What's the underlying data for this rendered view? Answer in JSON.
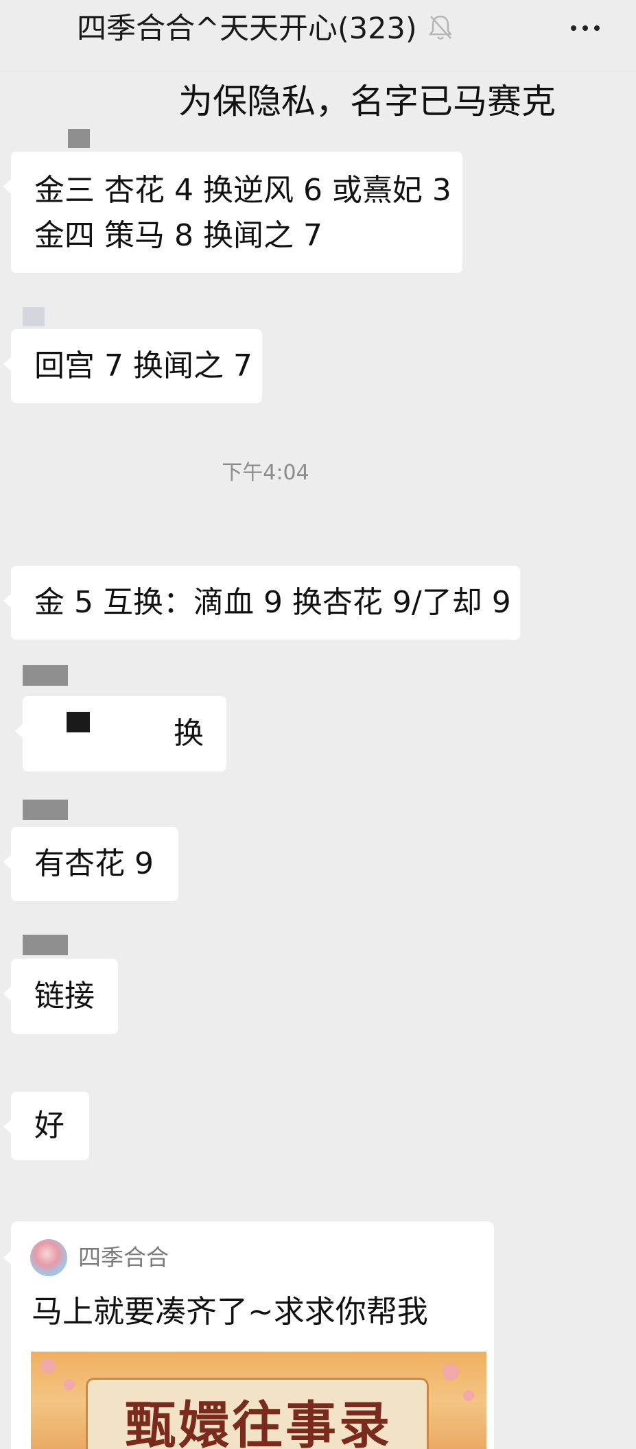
{
  "header": {
    "title": "四季合合^天天开心(323)",
    "mute_icon": "bell-slash-icon",
    "more_icon": "more-dots-icon"
  },
  "privacy_note": "为保隐私，名字已马赛克",
  "messages": [
    {
      "lines": [
        "金三 杏花 4 换逆风 6 或熹妃 3",
        "金四 策马 8 换闻之 7"
      ]
    },
    {
      "lines": [
        "回宫 7 换闻之 7"
      ]
    },
    {
      "lines": [
        "金 5 互换：滴血 9 换杏花 9/了却 9"
      ]
    },
    {
      "lines": [
        "换"
      ]
    },
    {
      "lines": [
        "有杏花 9"
      ]
    },
    {
      "lines": [
        "链接"
      ]
    },
    {
      "lines": [
        "好"
      ]
    }
  ],
  "timestamp": "下午4:04",
  "link_card": {
    "source_name": "四季合合",
    "title": "马上就要凑齐了~求求你帮我",
    "banner_text": "甄嬛往事录"
  },
  "colors": {
    "background": "#ededed",
    "bubble": "#ffffff",
    "text": "#191919",
    "muted_text": "#8c8c8c",
    "censor": "#8f8f8f"
  }
}
